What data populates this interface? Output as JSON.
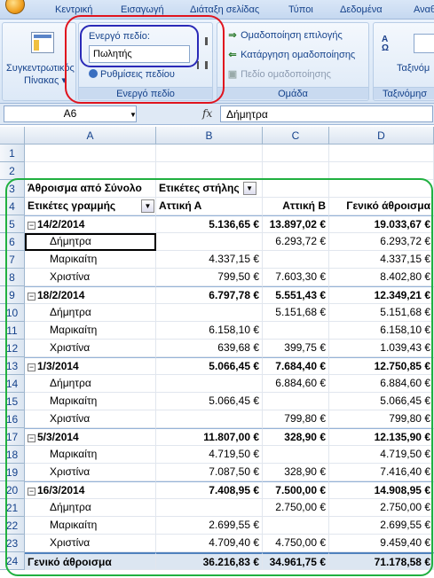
{
  "ribbon": {
    "tabs": [
      "Κεντρική",
      "Εισαγωγή",
      "Διάταξη σελίδας",
      "Τύποι",
      "Δεδομένα",
      "Αναθ"
    ],
    "pivot_table": {
      "label_line1": "Συγκεντρωτικός",
      "label_line2": "Πίνακας ▾",
      "icon": "pivot-table-icon"
    },
    "active_field": {
      "title": "Ενεργό πεδίο:",
      "value": "Πωλητής",
      "settings_label": "Ρυθμίσεις πεδίου",
      "group_label": "Ενεργό πεδίο"
    },
    "group": {
      "group_selection": "Ομαδοποίηση επιλογής",
      "ungroup": "Κατάργηση ομαδοποίησης",
      "group_field": "Πεδίο ομαδοποίησης",
      "group_label": "Ομάδα"
    },
    "sort": {
      "az": "A",
      "za": "Ω",
      "label": "Ταξινόμ",
      "group_label": "Ταξινόμησ"
    },
    "colors": {
      "red_outline": "#e0141e",
      "blue_outline": "#2a2ab8",
      "green_outline": "#20b040"
    }
  },
  "formula_bar": {
    "name_box": "A6",
    "fx": "fx",
    "value": "Δήμητρα"
  },
  "columns": [
    "A",
    "B",
    "C",
    "D"
  ],
  "rows": [
    {
      "n": "1",
      "a": "",
      "b": "",
      "c": "",
      "d": ""
    },
    {
      "n": "2",
      "a": "",
      "b": "",
      "c": "",
      "d": ""
    },
    {
      "n": "3",
      "a": "Άθροισμα από Σύνολο",
      "b": "Ετικέτες στήλης",
      "c": "",
      "d": ""
    },
    {
      "n": "4",
      "a": "Ετικέτες γραμμής",
      "b": "Αττική Α",
      "c": "Αττική Β",
      "d": "Γενικό άθροισμα"
    },
    {
      "n": "5",
      "a": "14/2/2014",
      "b": "5.136,65 €",
      "c": "13.897,02 €",
      "d": "19.033,67 €"
    },
    {
      "n": "6",
      "a": "Δήμητρα",
      "b": "",
      "c": "6.293,72 €",
      "d": "6.293,72 €"
    },
    {
      "n": "7",
      "a": "Μαρικαίτη",
      "b": "4.337,15 €",
      "c": "",
      "d": "4.337,15 €"
    },
    {
      "n": "8",
      "a": "Χριστίνα",
      "b": "799,50 €",
      "c": "7.603,30 €",
      "d": "8.402,80 €"
    },
    {
      "n": "9",
      "a": "18/2/2014",
      "b": "6.797,78 €",
      "c": "5.551,43 €",
      "d": "12.349,21 €"
    },
    {
      "n": "10",
      "a": "Δήμητρα",
      "b": "",
      "c": "5.151,68 €",
      "d": "5.151,68 €"
    },
    {
      "n": "11",
      "a": "Μαρικαίτη",
      "b": "6.158,10 €",
      "c": "",
      "d": "6.158,10 €"
    },
    {
      "n": "12",
      "a": "Χριστίνα",
      "b": "639,68 €",
      "c": "399,75 €",
      "d": "1.039,43 €"
    },
    {
      "n": "13",
      "a": "1/3/2014",
      "b": "5.066,45 €",
      "c": "7.684,40 €",
      "d": "12.750,85 €"
    },
    {
      "n": "14",
      "a": "Δήμητρα",
      "b": "",
      "c": "6.884,60 €",
      "d": "6.884,60 €"
    },
    {
      "n": "15",
      "a": "Μαρικαίτη",
      "b": "5.066,45 €",
      "c": "",
      "d": "5.066,45 €"
    },
    {
      "n": "16",
      "a": "Χριστίνα",
      "b": "",
      "c": "799,80 €",
      "d": "799,80 €"
    },
    {
      "n": "17",
      "a": "5/3/2014",
      "b": "11.807,00 €",
      "c": "328,90 €",
      "d": "12.135,90 €"
    },
    {
      "n": "18",
      "a": "Μαρικαίτη",
      "b": "4.719,50 €",
      "c": "",
      "d": "4.719,50 €"
    },
    {
      "n": "19",
      "a": "Χριστίνα",
      "b": "7.087,50 €",
      "c": "328,90 €",
      "d": "7.416,40 €"
    },
    {
      "n": "20",
      "a": "16/3/2014",
      "b": "7.408,95 €",
      "c": "7.500,00 €",
      "d": "14.908,95 €"
    },
    {
      "n": "21",
      "a": "Δήμητρα",
      "b": "",
      "c": "2.750,00 €",
      "d": "2.750,00 €"
    },
    {
      "n": "22",
      "a": "Μαρικαίτη",
      "b": "2.699,55 €",
      "c": "",
      "d": "2.699,55 €"
    },
    {
      "n": "23",
      "a": "Χριστίνα",
      "b": "4.709,40 €",
      "c": "4.750,00 €",
      "d": "9.459,40 €"
    },
    {
      "n": "24",
      "a": "Γενικό άθροισμα",
      "b": "36.216,83 €",
      "c": "34.961,75 €",
      "d": "71.178,58 €"
    }
  ]
}
